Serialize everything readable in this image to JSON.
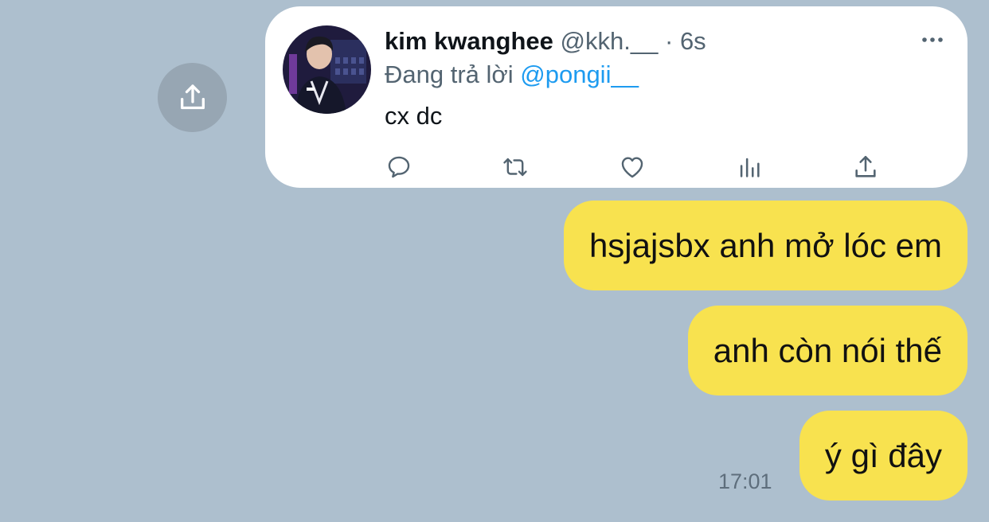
{
  "tweet": {
    "author_name": "kim kwanghee",
    "author_handle": "@kkh.__",
    "time": "6s",
    "time_separator": "·",
    "reply_prefix": "Đang trả lời",
    "reply_mention": "@pongii__",
    "text": "cx dc"
  },
  "messages": [
    {
      "text": "hsjajsbx anh mở lóc em"
    },
    {
      "text": "anh còn nói thế"
    },
    {
      "text": "ý gì đây"
    }
  ],
  "timestamp": "17:01",
  "colors": {
    "background": "#adbfce",
    "bubble": "#f8e24f",
    "twitter_blue": "#1d9bf0",
    "muted": "#536471"
  },
  "icons": {
    "share": "share-icon",
    "more": "more-icon",
    "reply": "reply-icon",
    "retweet": "retweet-icon",
    "like": "heart-icon",
    "views": "views-icon",
    "tweet_share": "share-icon"
  }
}
